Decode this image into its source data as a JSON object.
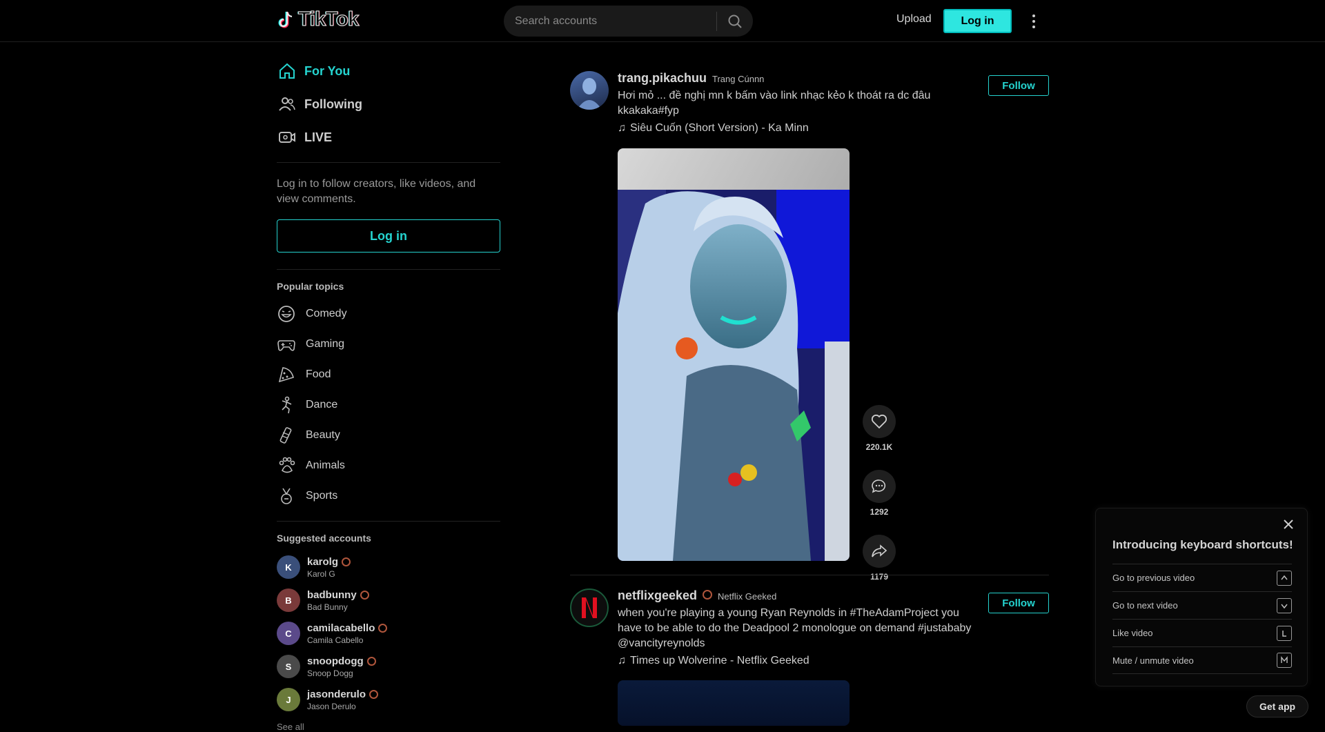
{
  "header": {
    "logo_text": "TikTok",
    "search_placeholder": "Search accounts",
    "upload_label": "Upload",
    "login_label": "Log in"
  },
  "sidebar": {
    "nav": [
      {
        "label": "For You",
        "icon": "home-icon",
        "active": true
      },
      {
        "label": "Following",
        "icon": "users-icon",
        "active": false
      },
      {
        "label": "LIVE",
        "icon": "live-icon",
        "active": false
      }
    ],
    "login_hint": "Log in to follow creators, like videos, and view comments.",
    "login_label": "Log in",
    "topics_title": "Popular topics",
    "topics": [
      {
        "label": "Comedy",
        "icon": "comedy-icon"
      },
      {
        "label": "Gaming",
        "icon": "gaming-icon"
      },
      {
        "label": "Food",
        "icon": "food-icon"
      },
      {
        "label": "Dance",
        "icon": "dance-icon"
      },
      {
        "label": "Beauty",
        "icon": "beauty-icon"
      },
      {
        "label": "Animals",
        "icon": "animals-icon"
      },
      {
        "label": "Sports",
        "icon": "sports-icon"
      }
    ],
    "suggested_title": "Suggested accounts",
    "accounts": [
      {
        "handle": "karolg",
        "name": "Karol G",
        "color": "#3a4f7a"
      },
      {
        "handle": "badbunny",
        "name": "Bad Bunny",
        "color": "#7a3a3a"
      },
      {
        "handle": "camilacabello",
        "name": "Camila Cabello",
        "color": "#5b4a8a"
      },
      {
        "handle": "snoopdogg",
        "name": "Snoop Dogg",
        "color": "#4a4a4a"
      },
      {
        "handle": "jasonderulo",
        "name": "Jason Derulo",
        "color": "#6a7a3a"
      }
    ],
    "see_all": "See all"
  },
  "posts": [
    {
      "handle": "trang.pikachuu",
      "nickname": "Trang Cúnnn",
      "caption": "Hơi mỏ ... đề nghị mn k bấm vào link nhạc kẻo k thoát ra dc đâu kkakaka#fyp",
      "music": "Siêu Cuốn (Short Version) - Ka Minn",
      "follow_label": "Follow",
      "likes": "220.1K",
      "comments": "1292",
      "shares": "1179"
    },
    {
      "handle": "netflixgeeked",
      "nickname": "Netflix Geeked",
      "caption": "when you're playing a young Ryan Reynolds in #TheAdamProject you have to be able to do the Deadpool 2 monologue on demand #justababy @vancityreynolds",
      "music": "Times up Wolverine - Netflix Geeked",
      "follow_label": "Follow"
    }
  ],
  "shortcuts": {
    "title": "Introducing keyboard shortcuts!",
    "items": [
      {
        "label": "Go to previous video",
        "key": "up-arrow-key-icon"
      },
      {
        "label": "Go to next video",
        "key": "down-arrow-key-icon"
      },
      {
        "label": "Like video",
        "key": "l-key-icon"
      },
      {
        "label": "Mute / unmute video",
        "key": "m-key-icon"
      }
    ]
  },
  "get_app_label": "Get app",
  "colors": {
    "accent": "#25d4d0",
    "background": "#000000",
    "login_fill": "#2ee6e0"
  }
}
